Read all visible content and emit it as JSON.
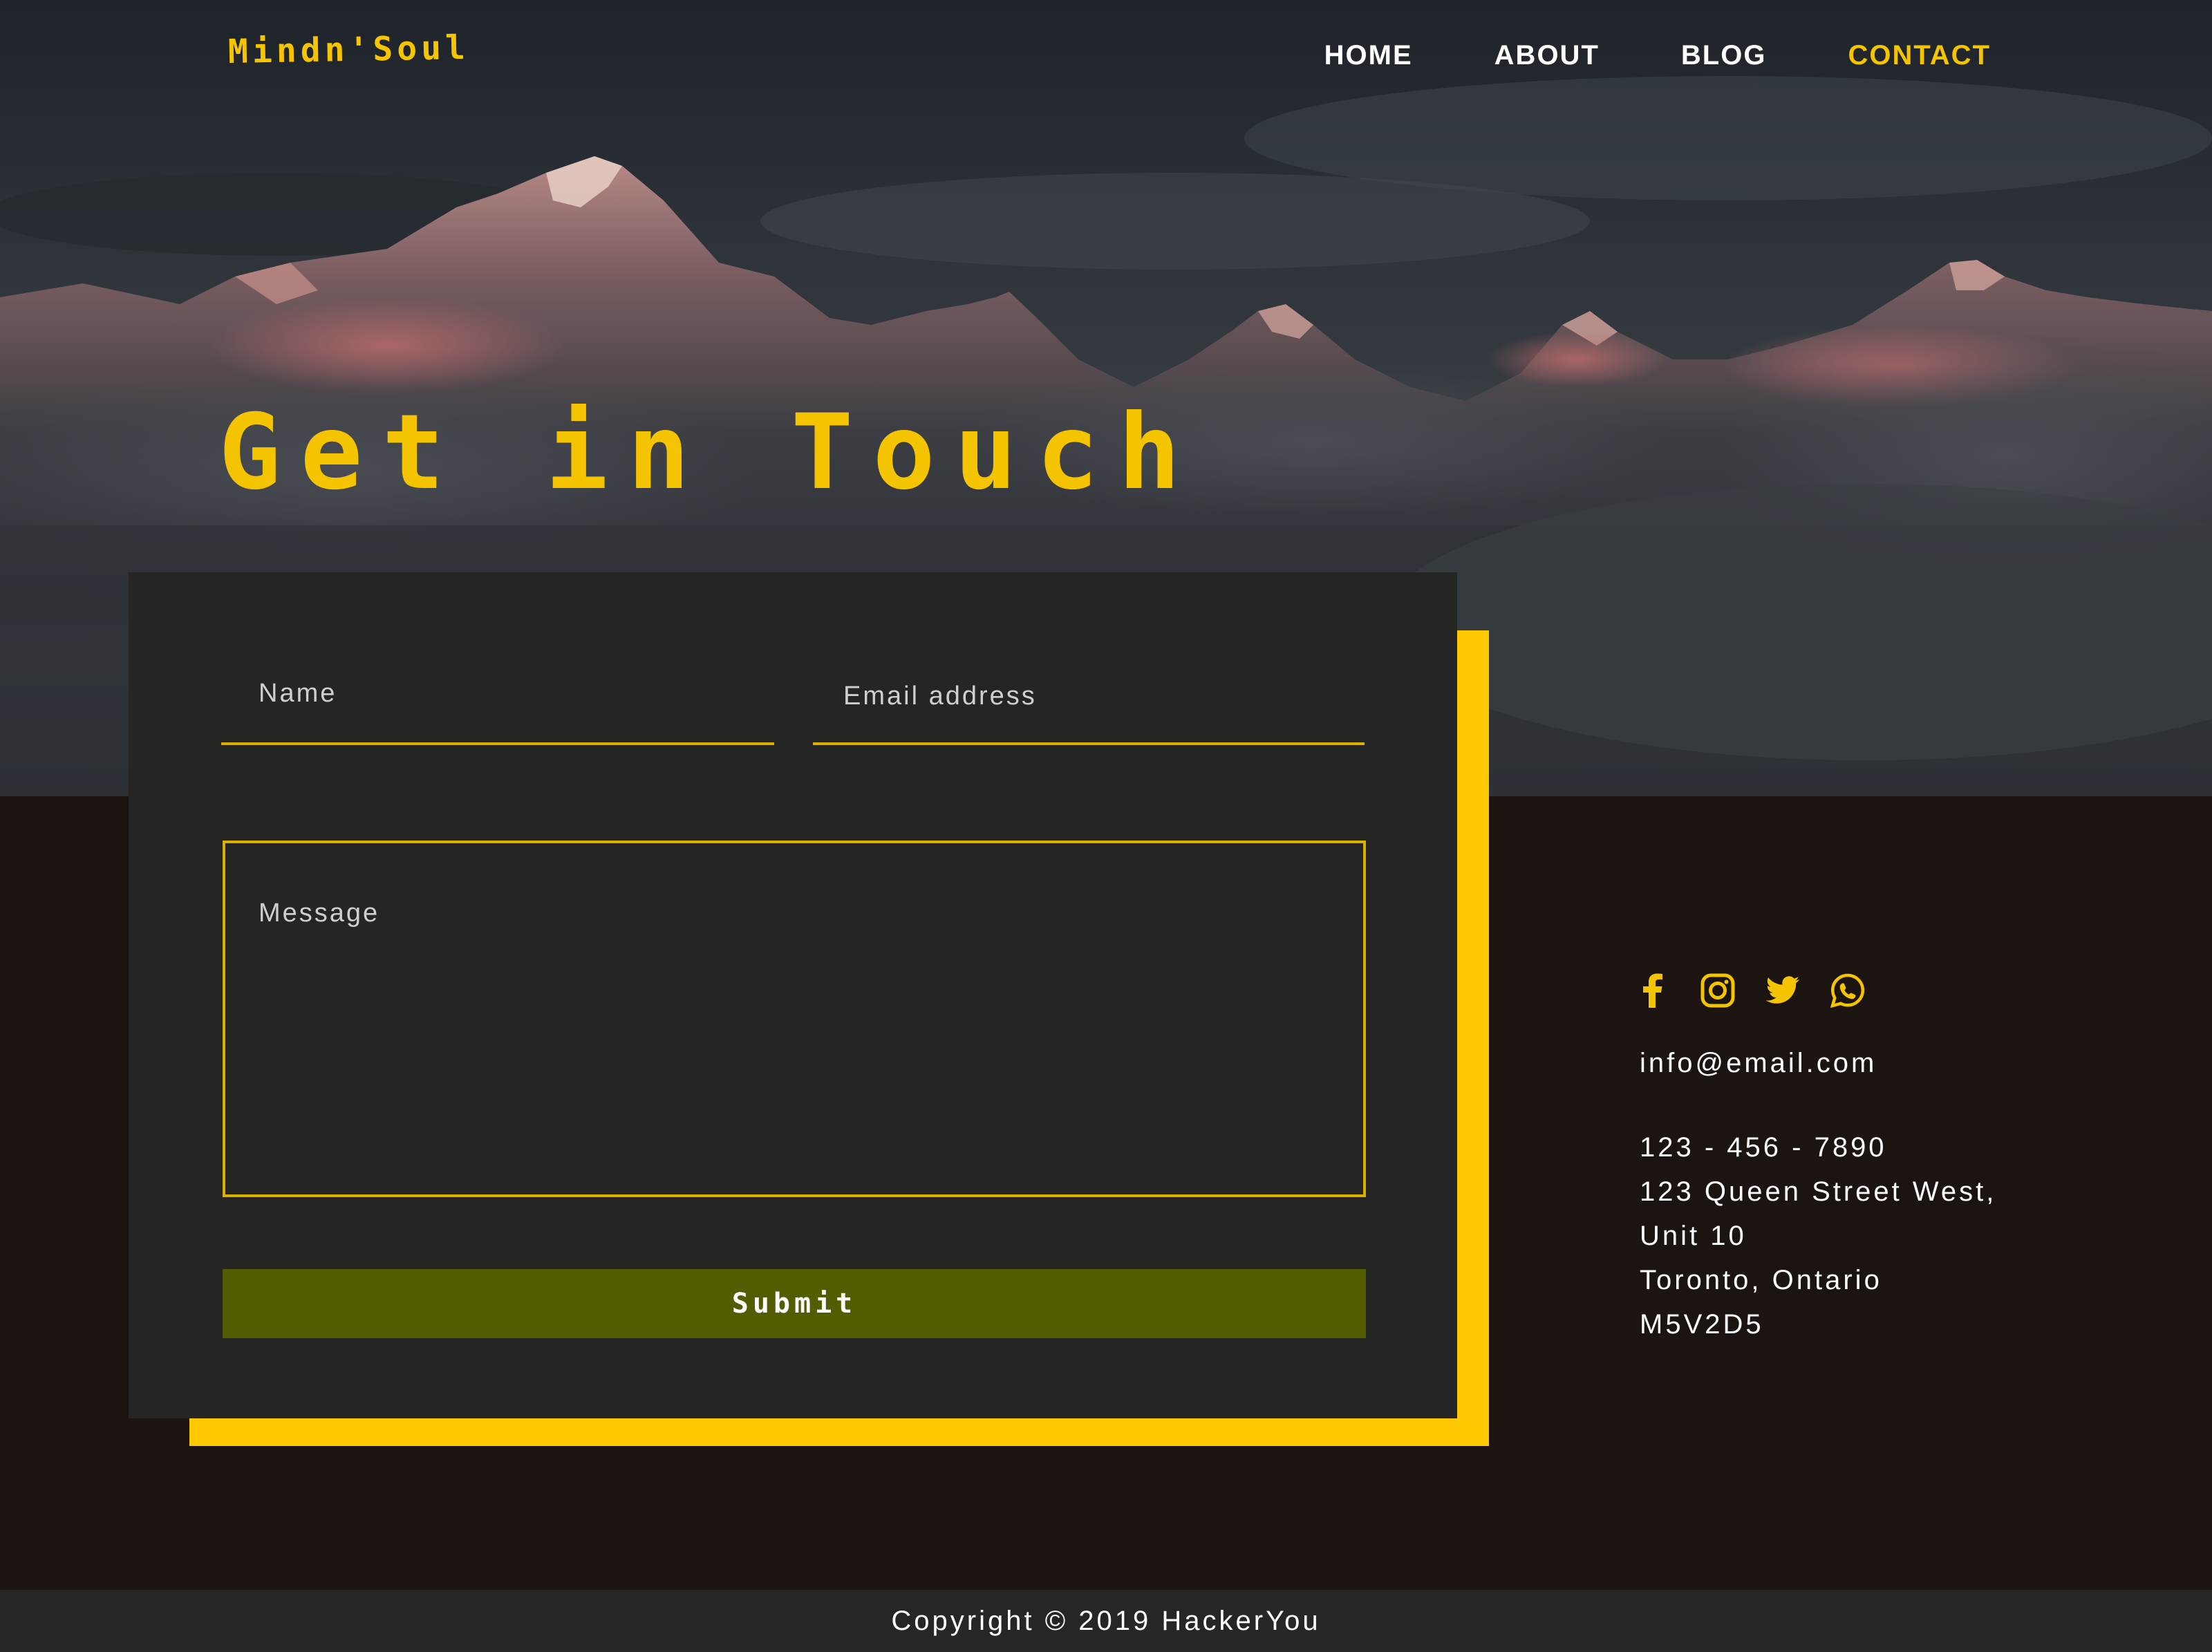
{
  "brand": {
    "logo_text": "Mindn'Soul",
    "accent_color": "#f5c400"
  },
  "nav": {
    "items": [
      {
        "label": "HOME",
        "active": false
      },
      {
        "label": "ABOUT",
        "active": false
      },
      {
        "label": "BLOG",
        "active": false
      },
      {
        "label": "CONTACT",
        "active": true
      }
    ]
  },
  "hero": {
    "title": "Get in Touch"
  },
  "form": {
    "name_placeholder": "Name",
    "email_placeholder": "Email address",
    "message_placeholder": "Message",
    "submit_label": "Submit",
    "submit_color": "#545c00",
    "card_shadow_color": "#ffc800"
  },
  "contact": {
    "social_icons": [
      "facebook-icon",
      "instagram-icon",
      "twitter-icon",
      "whatsapp-icon"
    ],
    "email": "info@email.com",
    "phone": "123 - 456 - 7890",
    "address_line1": "123 Queen Street West,",
    "address_line2": "Unit 10",
    "address_line3": "Toronto, Ontario",
    "postal_code": "M5V2D5"
  },
  "footer": {
    "copyright": "Copyright © 2019 HackerYou"
  }
}
